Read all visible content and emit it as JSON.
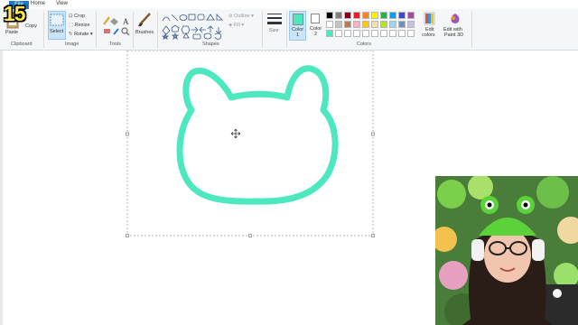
{
  "overlay": {
    "frame_counter": "15"
  },
  "menu": {
    "file": "File",
    "home": "Home",
    "view": "View"
  },
  "clipboard": {
    "paste": "Paste",
    "copy": "Copy",
    "group": "Clipboard"
  },
  "image": {
    "select": "Select",
    "crop": "Crop",
    "resize": "Resize",
    "rotate": "Rotate",
    "group": "Image"
  },
  "tools": {
    "group": "Tools"
  },
  "brushes": {
    "label": "Brushes"
  },
  "shapes": {
    "outline": "Outline",
    "fill": "Fill",
    "group": "Shapes"
  },
  "size": {
    "label": "Size"
  },
  "colors": {
    "color1_label": "Color",
    "color1_num": "1",
    "color2_label": "Color",
    "color2_num": "2",
    "edit_colors_line1": "Edit",
    "edit_colors_line2": "colors",
    "paint3d_line1": "Edit with",
    "paint3d_line2": "Paint 3D",
    "group": "Colors",
    "color1_value": "#4ee8c0",
    "color2_value": "#ffffff",
    "palette_row1": [
      "#000000",
      "#7f7f7f",
      "#880015",
      "#ed1c24",
      "#ff7f27",
      "#fff200",
      "#22b14c",
      "#00a2e8",
      "#3f48cc",
      "#a349a4"
    ],
    "palette_row2": [
      "#ffffff",
      "#c3c3c3",
      "#b97a57",
      "#ffaec9",
      "#ffc90e",
      "#efe4b0",
      "#b5e61d",
      "#99d9ea",
      "#7092be",
      "#c8bfe7"
    ],
    "palette_row3": [
      "#4ee8c0",
      "#ffffff",
      "#ffffff",
      "#ffffff",
      "#ffffff",
      "#ffffff",
      "#ffffff",
      "#ffffff",
      "#ffffff",
      "#ffffff"
    ]
  },
  "drawing": {
    "stroke_color": "#4ee8c0"
  }
}
